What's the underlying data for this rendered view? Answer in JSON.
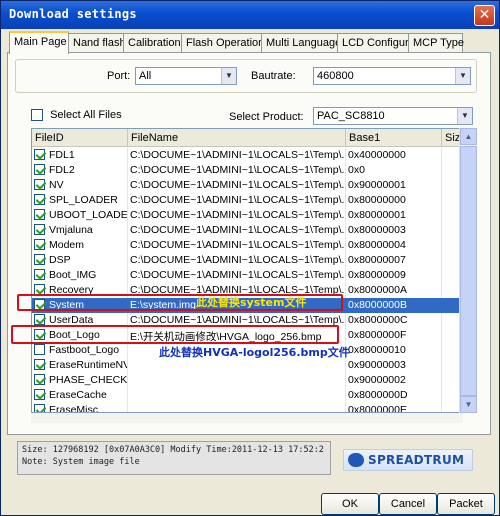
{
  "window": {
    "title": "Download settings",
    "close_glyph": "✕"
  },
  "tabs": [
    {
      "label": "Main Page",
      "active": true
    },
    {
      "label": "Nand flash",
      "active": false
    },
    {
      "label": "Calibration",
      "active": false
    },
    {
      "label": "Flash Operations",
      "active": false
    },
    {
      "label": "Multi Languages",
      "active": false
    },
    {
      "label": "LCD Configure",
      "active": false
    },
    {
      "label": "MCP Type",
      "active": false
    }
  ],
  "port": {
    "label": "Port:",
    "value": "All"
  },
  "bautrate": {
    "label": "Bautrate:",
    "value": "460800"
  },
  "select_all": {
    "label": "Select All Files",
    "checked": false
  },
  "product": {
    "label": "Select Product:",
    "value": "PAC_SC8810"
  },
  "grid": {
    "columns": [
      "FileID",
      "FileName",
      "Base1",
      "Size"
    ],
    "rows": [
      {
        "id": "FDL1",
        "file": "C:\\DOCUME~1\\ADMINI~1\\LOCALS~1\\Temp\\...",
        "base": "0x40000000",
        "checked": true
      },
      {
        "id": "FDL2",
        "file": "C:\\DOCUME~1\\ADMINI~1\\LOCALS~1\\Temp\\...",
        "base": "0x0",
        "checked": true
      },
      {
        "id": "NV",
        "file": "C:\\DOCUME~1\\ADMINI~1\\LOCALS~1\\Temp\\...",
        "base": "0x90000001",
        "checked": true
      },
      {
        "id": "SPL_LOADER",
        "file": "C:\\DOCUME~1\\ADMINI~1\\LOCALS~1\\Temp\\...",
        "base": "0x80000000",
        "checked": true
      },
      {
        "id": "UBOOT_LOADER",
        "file": "C:\\DOCUME~1\\ADMINI~1\\LOCALS~1\\Temp\\...",
        "base": "0x80000001",
        "checked": true
      },
      {
        "id": "Vmjaluna",
        "file": "C:\\DOCUME~1\\ADMINI~1\\LOCALS~1\\Temp\\...",
        "base": "0x80000003",
        "checked": true
      },
      {
        "id": "Modem",
        "file": "C:\\DOCUME~1\\ADMINI~1\\LOCALS~1\\Temp\\...",
        "base": "0x80000004",
        "checked": true
      },
      {
        "id": "DSP",
        "file": "C:\\DOCUME~1\\ADMINI~1\\LOCALS~1\\Temp\\...",
        "base": "0x80000007",
        "checked": true
      },
      {
        "id": "Boot_IMG",
        "file": "C:\\DOCUME~1\\ADMINI~1\\LOCALS~1\\Temp\\...",
        "base": "0x80000009",
        "checked": true
      },
      {
        "id": "Recovery",
        "file": "C:\\DOCUME~1\\ADMINI~1\\LOCALS~1\\Temp\\...",
        "base": "0x8000000A",
        "checked": true
      },
      {
        "id": "System",
        "file": "E:\\system.img",
        "base": "0x8000000B",
        "checked": true
      },
      {
        "id": "UserData",
        "file": "C:\\DOCUME~1\\ADMINI~1\\LOCALS~1\\Temp\\...",
        "base": "0x8000000C",
        "checked": true
      },
      {
        "id": "Boot_Logo",
        "file": "E:\\开关机动画修改\\HVGA_logo_256.bmp",
        "base": "0x8000000F",
        "checked": true
      },
      {
        "id": "Fastboot_Logo",
        "file": "",
        "base": "0x80000010",
        "checked": false
      },
      {
        "id": "EraseRuntimeNV",
        "file": "",
        "base": "0x90000003",
        "checked": true
      },
      {
        "id": "PHASE_CHECK",
        "file": "",
        "base": "0x90000002",
        "checked": true
      },
      {
        "id": "EraseCache",
        "file": "",
        "base": "0x8000000D",
        "checked": true
      },
      {
        "id": "EraseMisc",
        "file": "",
        "base": "0x8000000E",
        "checked": true
      }
    ]
  },
  "annotations": {
    "system": "此处替换system文件",
    "logo": "此处替换HVGA-logol256.bmp文件",
    "highlight_color": "#ffe600",
    "blue_color": "#1030c0",
    "box_color": "#d0101a"
  },
  "status": {
    "line1": "Size: 127968192 [0x07A0A3C0] Modify Time:2011-12-13 17:52:2",
    "line2": "Note: System image file"
  },
  "logo": {
    "text": "SPREADTRUM"
  },
  "buttons": {
    "ok": "OK",
    "cancel": "Cancel",
    "packet": "Packet"
  },
  "colors": {
    "selection": "#316ac5",
    "tab_accent": "#ffc83c",
    "titlebar": "#0a4fcf"
  }
}
